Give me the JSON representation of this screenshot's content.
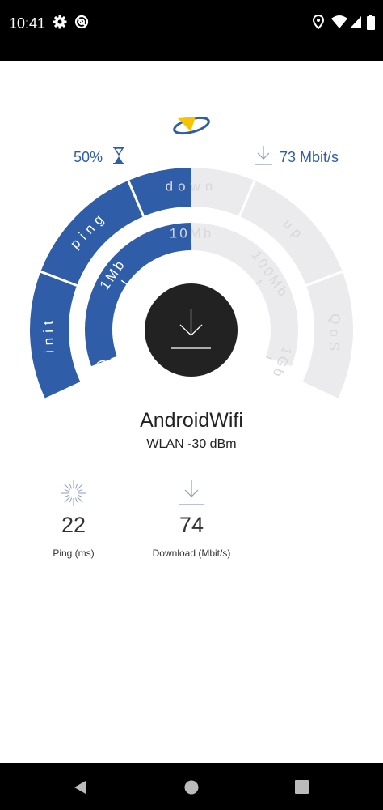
{
  "status_bar": {
    "time": "10:41"
  },
  "test": {
    "progress_percent": "50%",
    "rate": "73 Mbit/s",
    "outer_ring_labels": [
      "init",
      "ping",
      "down",
      "up",
      "QoS"
    ],
    "inner_ring_labels": [
      "0",
      "1Mb",
      "10Mb",
      "100Mb",
      "1Gb"
    ],
    "progress_fraction": 0.5,
    "accent_color": "#2f5da8",
    "inactive_color": "#ebebed"
  },
  "network": {
    "name": "AndroidWifi",
    "signal": "WLAN   -30 dBm"
  },
  "results": {
    "ping": {
      "value": "22",
      "label": "Ping  (ms)",
      "icon": "ping-burst-icon"
    },
    "download": {
      "value": "74",
      "label": "Download  (Mbit/s)",
      "icon": "download-icon"
    }
  }
}
